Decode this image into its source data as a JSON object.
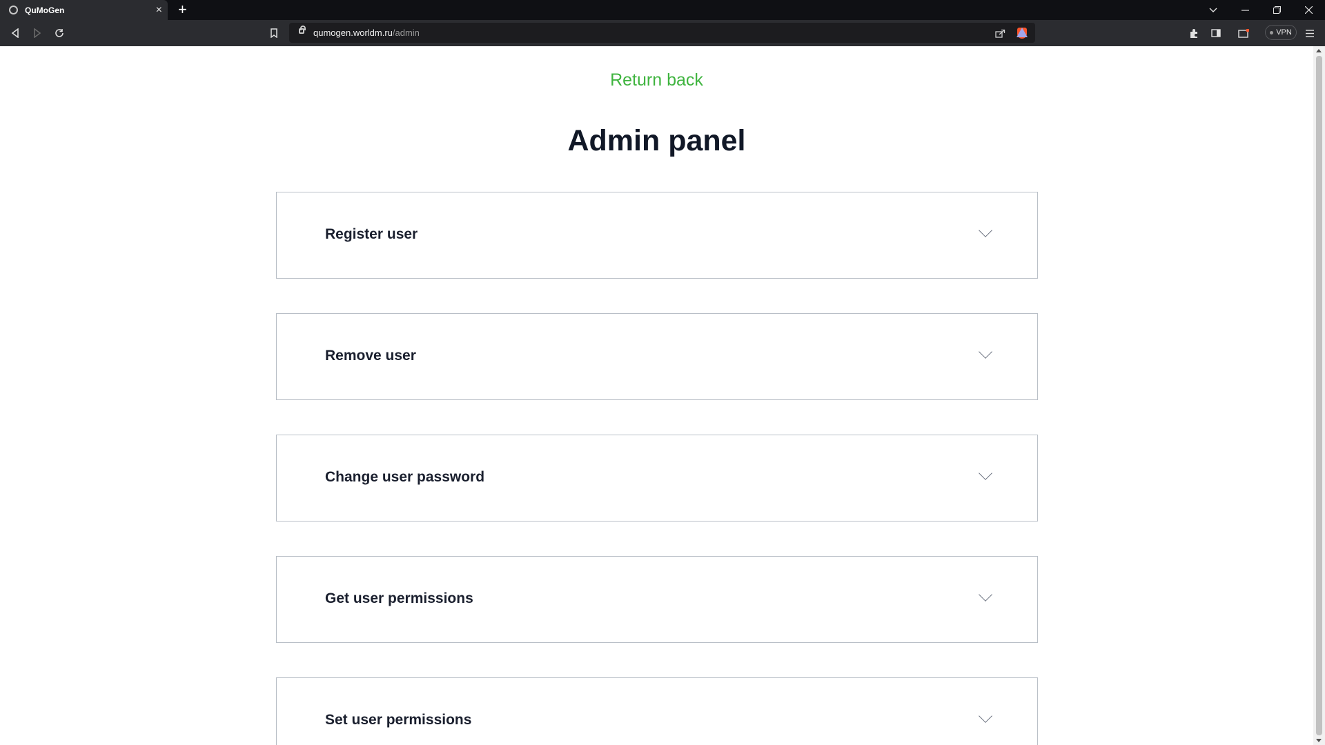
{
  "browser": {
    "tab": {
      "title": "QuMoGen",
      "close_glyph": "×"
    },
    "new_tab_glyph": "+",
    "address": {
      "domain": "qumogen.worldm.ru",
      "path": "/admin"
    },
    "vpn_label": "VPN",
    "icons": [
      "back-icon",
      "forward-icon",
      "reload-icon",
      "bookmark-icon",
      "share-icon",
      "brave-shields-icon",
      "brave-rewards-icon",
      "extensions-icon",
      "sidebar-icon",
      "wallet-icon",
      "menu-icon"
    ]
  },
  "page": {
    "return_link": "Return back",
    "title": "Admin panel",
    "sections": [
      {
        "label": "Register user"
      },
      {
        "label": "Remove user"
      },
      {
        "label": "Change user password"
      },
      {
        "label": "Get user permissions"
      },
      {
        "label": "Set user permissions"
      }
    ]
  },
  "colors": {
    "link_green": "#3fb43f",
    "title_text": "#111827",
    "border": "#b9bfc7",
    "chrome_dark": "#0f1014",
    "chrome_toolbar": "#2b2c30"
  }
}
